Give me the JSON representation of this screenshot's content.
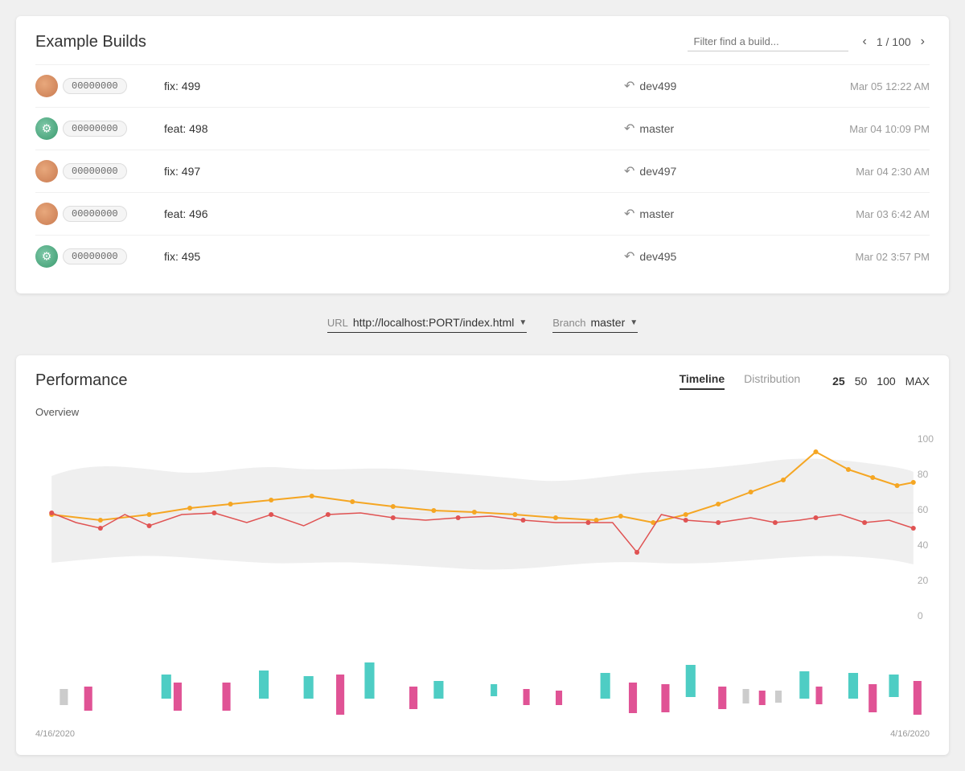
{
  "page": {
    "title": "Example Builds"
  },
  "filter": {
    "placeholder": "Filter find a build..."
  },
  "pagination": {
    "current": 1,
    "total": 100,
    "label": "1 / 100"
  },
  "builds": [
    {
      "id": "00000000",
      "avatar_type": "a",
      "message": "fix: 499",
      "branch": "dev499",
      "date": "Mar 05 12:22 AM"
    },
    {
      "id": "00000000",
      "avatar_type": "b",
      "message": "feat: 498",
      "branch": "master",
      "date": "Mar 04 10:09 PM"
    },
    {
      "id": "00000000",
      "avatar_type": "a",
      "message": "fix: 497",
      "branch": "dev497",
      "date": "Mar 04 2:30 AM"
    },
    {
      "id": "00000000",
      "avatar_type": "a",
      "message": "feat: 496",
      "branch": "master",
      "date": "Mar 03 6:42 AM"
    },
    {
      "id": "00000000",
      "avatar_type": "b",
      "message": "fix: 495",
      "branch": "dev495",
      "date": "Mar 02 3:57 PM"
    }
  ],
  "url_selector": {
    "label": "URL",
    "value": "http://localhost:PORT/index.html"
  },
  "branch_selector": {
    "label": "Branch",
    "value": "master"
  },
  "performance": {
    "title": "Performance",
    "tabs": [
      "Timeline",
      "Distribution"
    ],
    "active_tab": "Timeline",
    "size_buttons": [
      "25",
      "50",
      "100",
      "MAX"
    ],
    "overview_label": "Overview",
    "y_axis": [
      "100",
      "80",
      "60",
      "40",
      "20",
      "0"
    ],
    "x_axis_left": "4/16/2020",
    "x_axis_right": "4/16/2020"
  }
}
